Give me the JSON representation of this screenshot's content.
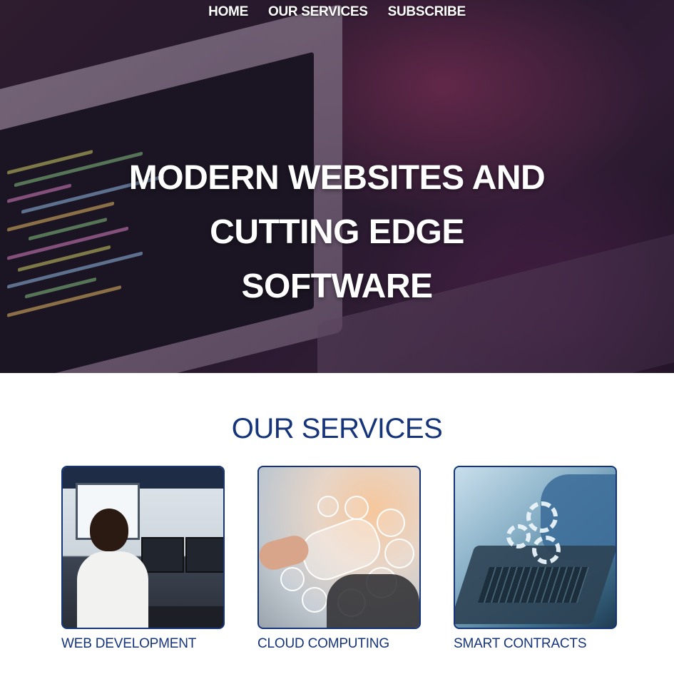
{
  "nav": {
    "items": [
      {
        "label": "HOME"
      },
      {
        "label": "OUR SERVICES"
      },
      {
        "label": "SUBSCRIBE"
      }
    ]
  },
  "hero": {
    "title_lines": [
      "MODERN WEBSITES AND",
      "CUTTING EDGE",
      "SOFTWARE"
    ]
  },
  "services": {
    "heading": "OUR SERVICES",
    "cards": [
      {
        "label": "WEB DEVELOPMENT"
      },
      {
        "label": "CLOUD COMPUTING"
      },
      {
        "label": "SMART CONTRACTS"
      }
    ]
  },
  "colors": {
    "brand_blue": "#16347a",
    "hero_overlay": "#3a2238",
    "text_light": "#ffffff"
  }
}
